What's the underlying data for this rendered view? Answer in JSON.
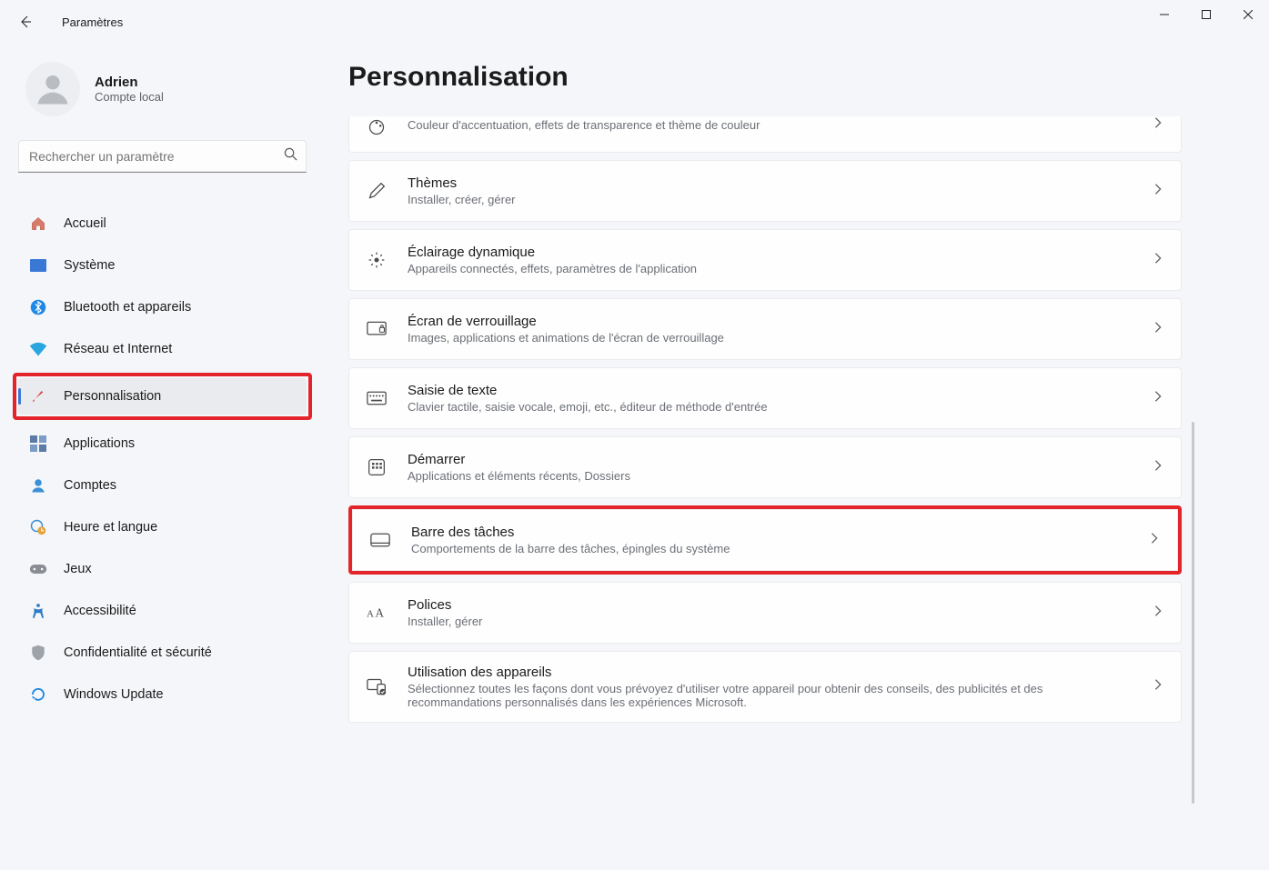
{
  "window": {
    "title": "Paramètres"
  },
  "user": {
    "name": "Adrien",
    "account_type": "Compte local"
  },
  "search": {
    "placeholder": "Rechercher un paramètre"
  },
  "nav": {
    "items": [
      {
        "label": "Accueil"
      },
      {
        "label": "Système"
      },
      {
        "label": "Bluetooth et appareils"
      },
      {
        "label": "Réseau et Internet"
      },
      {
        "label": "Personnalisation"
      },
      {
        "label": "Applications"
      },
      {
        "label": "Comptes"
      },
      {
        "label": "Heure et langue"
      },
      {
        "label": "Jeux"
      },
      {
        "label": "Accessibilité"
      },
      {
        "label": "Confidentialité et sécurité"
      },
      {
        "label": "Windows Update"
      }
    ]
  },
  "page": {
    "title": "Personnalisation"
  },
  "cards": [
    {
      "title": "",
      "sub": "Couleur d'accentuation, effets de transparence et thème de couleur"
    },
    {
      "title": "Thèmes",
      "sub": "Installer, créer, gérer"
    },
    {
      "title": "Éclairage dynamique",
      "sub": "Appareils connectés, effets, paramètres de l'application"
    },
    {
      "title": "Écran de verrouillage",
      "sub": "Images, applications et animations de l'écran de verrouillage"
    },
    {
      "title": "Saisie de texte",
      "sub": "Clavier tactile, saisie vocale, emoji, etc., éditeur de méthode d'entrée"
    },
    {
      "title": "Démarrer",
      "sub": "Applications et éléments récents, Dossiers"
    },
    {
      "title": "Barre des tâches",
      "sub": "Comportements de la barre des tâches, épingles du système"
    },
    {
      "title": "Polices",
      "sub": "Installer, gérer"
    },
    {
      "title": "Utilisation des appareils",
      "sub": "Sélectionnez toutes les façons dont vous prévoyez d'utiliser votre appareil pour obtenir des conseils, des publicités et des recommandations personnalisés dans les expériences Microsoft."
    }
  ]
}
